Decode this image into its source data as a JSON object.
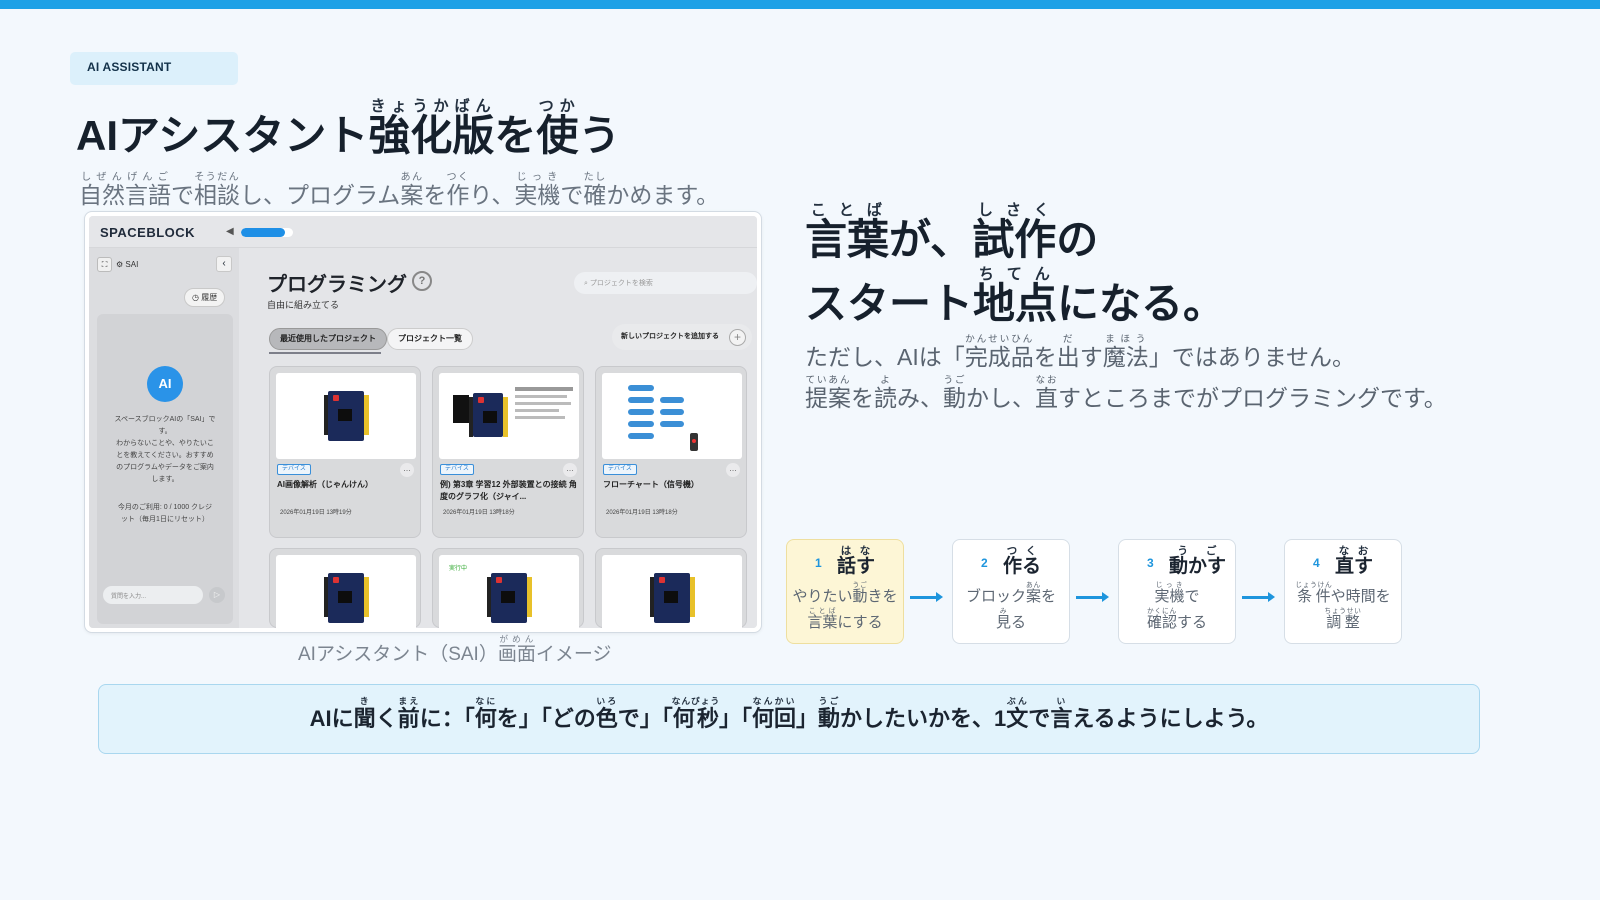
{
  "tag": "AI ASSISTANT",
  "title": {
    "prefix": "AIアシスタント",
    "kyouka": "強化",
    "kyouka_rt": "きょうか",
    "ban": "版",
    "ban_rt": "ばん",
    "wo": "を",
    "tsuka": "使",
    "tsuka_rt": "つか",
    "u": "う"
  },
  "subtitle": {
    "a": "自然言語",
    "a_rt": "しぜんげんご",
    "b": "で",
    "c": "相談",
    "c_rt": "そうだん",
    "d": "し、プログラム",
    "e": "案",
    "e_rt": "あん",
    "f": "を",
    "g": "作",
    "g_rt": "つく",
    "h": "り、",
    "i": "実機",
    "i_rt": "じっき",
    "j": "で",
    "k": "確",
    "k_rt": "たし",
    "l": "かめます。"
  },
  "app": {
    "logo": "SPACEBLOCK",
    "volume_icon": "speaker-icon",
    "volume_level": 0.85,
    "sidebar": {
      "fullscreen_icon": "⛶",
      "sai_label": "SAI",
      "back_icon": "‹",
      "history_label": "履歴",
      "avatar": "AI",
      "message_lines": [
        "スペースブロックAIの「SAI」で",
        "す。",
        "わからないことや、やりたいこ",
        "とを教えてください。おすすめ",
        "のプログラムやデータをご案内",
        "します。"
      ],
      "credit_lines": [
        "今月のご利用: 0 / 1000 クレジ",
        "ット（毎月1日にリセット）"
      ],
      "input_placeholder": "質問を入力...",
      "send_icon": "▷",
      "footer_note": "0 / 1000 クレジット"
    },
    "main": {
      "title": "プログラミング",
      "help": "?",
      "subtitle": "自由に組み立てる",
      "search_placeholder": "プロジェクトを検索",
      "tab_recent": "最近使用したプロジェクト",
      "tab_list": "プロジェクト一覧",
      "new_project": "新しいプロジェクトを追加する",
      "plus": "+",
      "cards": [
        {
          "badge": "デバイス",
          "title": "AI画像解析（じゃんけん）",
          "date": "2026年01月19日 13時19分"
        },
        {
          "badge": "デバイス",
          "title": "例) 第3章 学習12 外部装置との接続 角度のグラフ化（ジャイ...",
          "date": "2026年01月19日 13時18分"
        },
        {
          "badge": "デバイス",
          "title": "フローチャート（信号機）",
          "date": "2026年01月19日 13時18分"
        }
      ],
      "card2_badge": "実行中"
    }
  },
  "caption": {
    "a": "AIアシスタント（SAI）",
    "b": "画面",
    "b_rt": "がめん",
    "c": "イメージ"
  },
  "headline": {
    "l1a": "言葉",
    "l1a_rt": "ことば",
    "l1b": "が、",
    "l1c": "試作",
    "l1c_rt": "しさく",
    "l1d": "の",
    "l2a": "スタート",
    "l2b": "地点",
    "l2b_rt": "ちてん",
    "l2c": "になる。"
  },
  "body": {
    "l1a": "ただし、AIは「",
    "l1b": "完成品",
    "l1b_rt": "かんせいひん",
    "l1c": "を",
    "l1d": "出",
    "l1d_rt": "だ",
    "l1e": "す",
    "l1f": "魔法",
    "l1f_rt": "まほう",
    "l1g": "」ではありません。",
    "l2a": "提案",
    "l2a_rt": "ていあん",
    "l2b": "を",
    "l2c": "読",
    "l2c_rt": "よ",
    "l2d": "み、",
    "l2e": "動",
    "l2e_rt": "うご",
    "l2f": "かし、",
    "l2g": "直",
    "l2g_rt": "なお",
    "l2h": "すところまでがプログラミングです。"
  },
  "steps": [
    {
      "num": "1",
      "title": "話す",
      "title_rt": "はな",
      "d1a": "やりたい",
      "d1b": "動",
      "d1b_rt": "うご",
      "d1c": "きを",
      "d2a": "言葉",
      "d2a_rt": "ことば",
      "d2b": "にする"
    },
    {
      "num": "2",
      "title": "作る",
      "title_rt": "つく",
      "d1a": "ブロック",
      "d1b": "案",
      "d1b_rt": "あん",
      "d1c": "を",
      "d2a": "見",
      "d2a_rt": "み",
      "d2b": "る"
    },
    {
      "num": "3",
      "title": "動かす",
      "title_rt": "うご",
      "d1a": "",
      "d1b": "実機",
      "d1b_rt": "じっき",
      "d1c": "で",
      "d2a": "確認",
      "d2a_rt": "かくにん",
      "d2b": "する"
    },
    {
      "num": "4",
      "title": "直す",
      "title_rt": "なお",
      "d1a": "",
      "d1b": "条件",
      "d1b_rt": "じょうけん",
      "d1c": "や時間を",
      "d2a": "調整",
      "d2a_rt": "ちょうせい",
      "d2b": ""
    }
  ],
  "tip": {
    "a": "AIに",
    "b": "聞",
    "b_rt": "き",
    "c": "く",
    "d": "前",
    "d_rt": "まえ",
    "e": "に：「",
    "f": "何",
    "f_rt": "なに",
    "g": "を」「どの",
    "h": "色",
    "h_rt": "いろ",
    "i": "で」「",
    "j": "何秒",
    "j_rt": "なんびょう",
    "k": "」「",
    "l": "何回",
    "l_rt": "なんかい",
    "m": "」",
    "n": "動",
    "n_rt": "うご",
    "o": "かしたいかを、1",
    "p": "文",
    "p_rt": "ぶん",
    "q": "で",
    "r": "言",
    "r_rt": "い",
    "s": "えるようにしよう。"
  },
  "colors": {
    "accent": "#1ea1e6",
    "active_step": "#fdf6d6",
    "tip_bg": "#e2f3fc"
  }
}
